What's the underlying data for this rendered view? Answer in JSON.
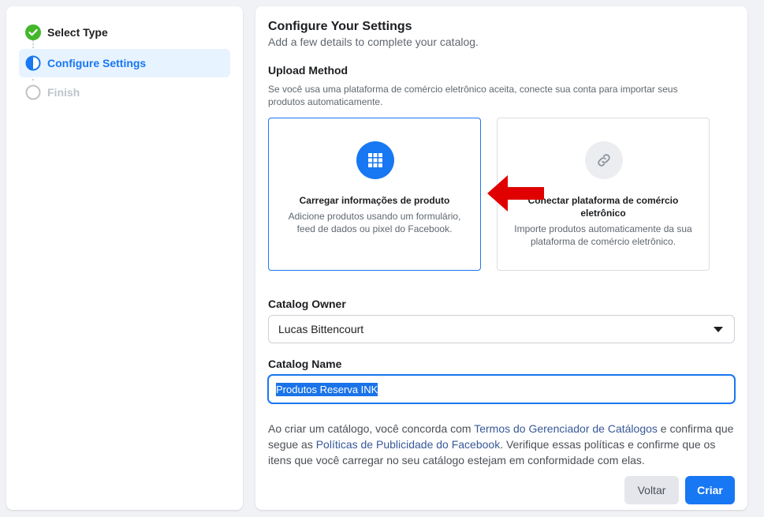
{
  "steps": [
    {
      "label": "Select Type",
      "state": "done"
    },
    {
      "label": "Configure Settings",
      "state": "active"
    },
    {
      "label": "Finish",
      "state": "pending"
    }
  ],
  "main": {
    "title": "Configure Your Settings",
    "subtitle": "Add a few details to complete your catalog.",
    "upload_method": {
      "label": "Upload Method",
      "help": "Se você usa uma plataforma de comércio eletrônico aceita, conecte sua conta para importar seus produtos automaticamente.",
      "options": [
        {
          "title": "Carregar informações de produto",
          "description": "Adicione produtos usando um formulário, feed de dados ou pixel do Facebook.",
          "icon": "grid-icon",
          "selected": true
        },
        {
          "title": "Conectar plataforma de comércio eletrônico",
          "description": "Importe produtos automaticamente da sua plataforma de comércio eletrônico.",
          "icon": "link-icon",
          "selected": false
        }
      ]
    },
    "catalog_owner": {
      "label": "Catalog Owner",
      "value": "Lucas Bittencourt"
    },
    "catalog_name": {
      "label": "Catalog Name",
      "value": "Produtos Reserva INK"
    },
    "legal": {
      "part1": "Ao criar um catálogo, você concorda com ",
      "link1": "Termos do Gerenciador de Catálogos",
      "part2": " e confirma que segue as ",
      "link2": "Políticas de Publicidade do Facebook",
      "part3": ". Verifique essas políticas e confirme que os itens que você carregar no seu catálogo estejam em conformidade com elas."
    },
    "buttons": {
      "back": "Voltar",
      "create": "Criar"
    }
  },
  "colors": {
    "accent": "#1877f2",
    "success": "#42b72a",
    "annotation_arrow": "#e00000"
  }
}
